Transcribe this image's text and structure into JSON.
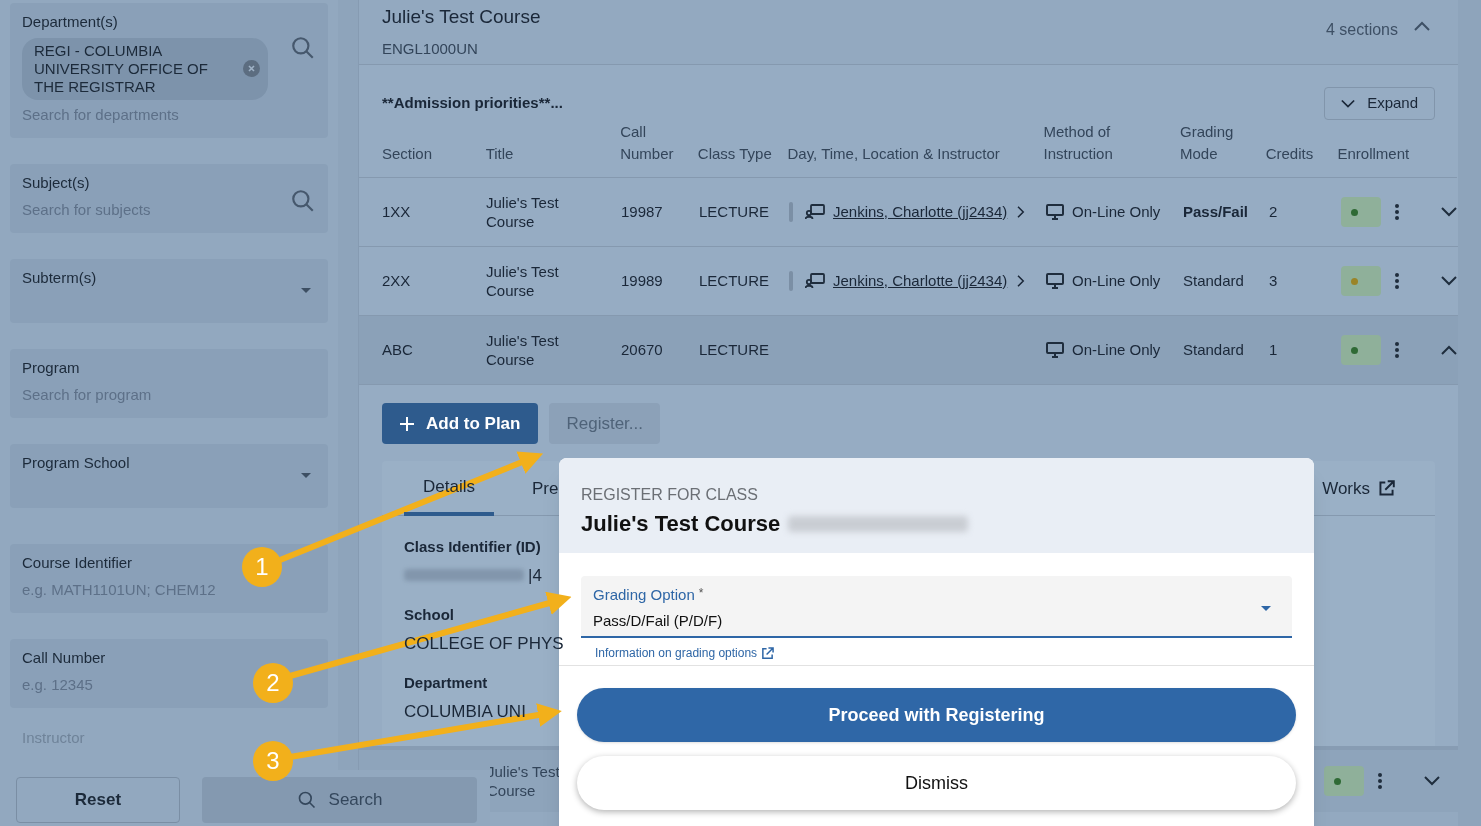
{
  "sidebar": {
    "fields": [
      {
        "kind": "chips",
        "label": "Department(s)",
        "chips": [
          "REGI - COLUMBIA UNIVERSITY OFFICE OF THE REGISTRAR"
        ],
        "placeholder": "Search for departments"
      },
      {
        "kind": "search",
        "label": "Subject(s)",
        "placeholder": "Search for subjects"
      },
      {
        "kind": "select",
        "label": "Subterm(s)"
      },
      {
        "kind": "text",
        "label": "Program",
        "placeholder": "Search for program"
      },
      {
        "kind": "select",
        "label": "Program School"
      },
      {
        "kind": "text",
        "label": "Course Identifier",
        "placeholder": "e.g. MATH1101UN; CHEM12"
      },
      {
        "kind": "text",
        "label": "Call Number",
        "placeholder": "e.g. 12345"
      },
      {
        "kind": "faded",
        "label": "Instructor"
      }
    ],
    "reset": "Reset",
    "search": "Search"
  },
  "course": {
    "title": "Julie's Test Course",
    "code": "ENGL1000UN",
    "sections": "4 sections",
    "expanded": true,
    "notice": "**Admission priorities**...",
    "expand_button": "Expand",
    "columns": [
      "Section",
      "Title",
      "Call Number",
      "Class Type",
      "Day, Time, Location & Instructor",
      "Method of Instruction",
      "Grading Mode",
      "Credits",
      "Enrollment"
    ],
    "rows": [
      {
        "section": "1XX",
        "title": "Julie's Test Course",
        "call_number": "19987",
        "class_type": "LECTURE",
        "instructor": "Jenkins, Charlotte (jj2434)",
        "method": "On-Line Only",
        "grading": "Pass/Fail",
        "grading_bold": true,
        "credits": "2",
        "color": "#2f6a35",
        "expanded": false
      },
      {
        "section": "2XX",
        "title": "Julie's Test Course",
        "call_number": "19989",
        "class_type": "LECTURE",
        "instructor": "Jenkins, Charlotte (jj2434)",
        "method": "On-Line Only",
        "grading": "Standard",
        "grading_bold": false,
        "credits": "3",
        "color": "#9a8428",
        "expanded": false
      },
      {
        "section": "ABC",
        "title": "Julie's Test Course",
        "call_number": "20670",
        "class_type": "LECTURE",
        "method": "On-Line Only",
        "grading": "Standard",
        "grading_bold": false,
        "credits": "1",
        "color": "#2f6a35",
        "expanded": true
      }
    ],
    "add_to_plan": "Add to Plan",
    "register": {
      "label": "Register...",
      "disabled": true
    },
    "tabs": [
      {
        "label": "Details",
        "selected": true
      },
      {
        "label": "Pre",
        "selected": false
      },
      {
        "label": "Works",
        "selected": false
      }
    ],
    "details": [
      {
        "label": "Class Identifier (ID)",
        "value": "|4"
      },
      {
        "label": "School",
        "value": "COLLEGE OF PHYS"
      },
      {
        "label": "Department",
        "value": "COLUMBIA UNI"
      }
    ],
    "next_row": {
      "title": "Julie's Test Course",
      "color": "#2f6a35"
    }
  },
  "modal": {
    "eyebrow": "REGISTER FOR CLASS",
    "title": "Julie's Test Course",
    "field": {
      "label": "Grading Option",
      "required": "*",
      "value": "Pass/D/Fail (P/D/F)"
    },
    "link": "Information on grading options",
    "primary": "Proceed with Registering",
    "secondary": "Dismiss"
  },
  "callouts": [
    "1",
    "2",
    "3"
  ]
}
